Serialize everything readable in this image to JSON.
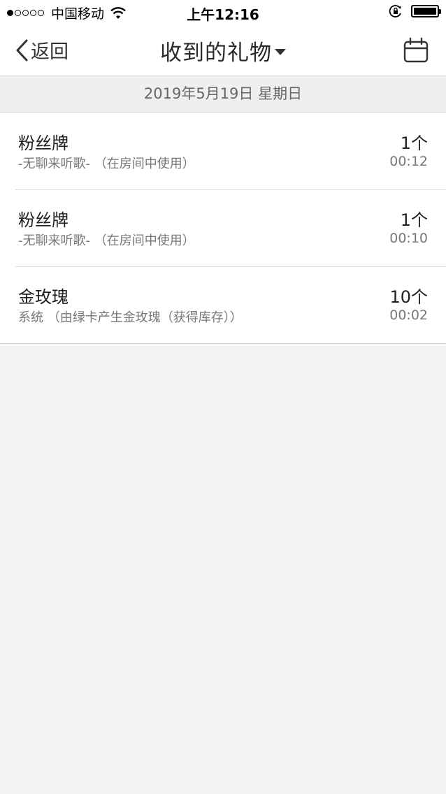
{
  "status_bar": {
    "carrier": "中国移动",
    "time": "上午12:16"
  },
  "nav": {
    "back_label": "返回",
    "title": "收到的礼物",
    "title_icon": "caret-down-icon",
    "right_icon": "calendar-icon"
  },
  "date_header": "2019年5月19日 星期日",
  "gifts": [
    {
      "name": "粉丝牌",
      "detail": "-无聊来听歌- （在房间中使用）",
      "count": "1个",
      "time": "00:12"
    },
    {
      "name": "粉丝牌",
      "detail": "-无聊来听歌- （在房间中使用）",
      "count": "1个",
      "time": "00:10"
    },
    {
      "name": "金玫瑰",
      "detail": "系统 （由绿卡产生金玫瑰（获得库存））",
      "count": "10个",
      "time": "00:02"
    }
  ],
  "colors": {
    "background": "#f4f4f4",
    "surface": "#ffffff",
    "primary_text": "#1e1e1e",
    "secondary_text": "#777777"
  }
}
